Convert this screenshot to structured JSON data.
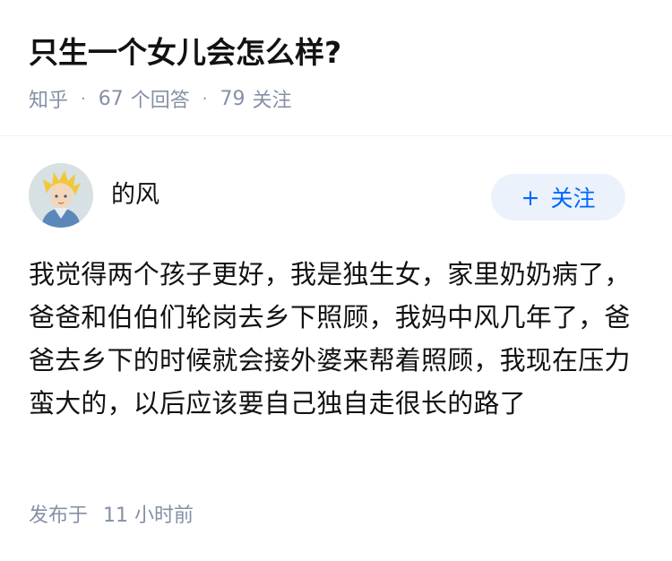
{
  "question": {
    "title": "只生一个女儿会怎么样?",
    "source": "知乎",
    "dot": "·",
    "answer_count": "67",
    "answer_label": "个回答",
    "follower_count": "79",
    "follower_label": "关注"
  },
  "answer": {
    "author_name": "的风",
    "avatar_icon": "anime-avatar-icon",
    "follow_button": {
      "icon": "+",
      "label": "关注"
    },
    "content": "我觉得两个孩子更好，我是独生女，家里奶奶病了，爸爸和伯伯们轮岗去乡下照顾，我妈中风几年了，爸爸去乡下的时候就会接外婆来帮着照顾，我现在压力蛮大的，以后应该要自己独自走很长的路了",
    "published_label": "发布于",
    "published_time": "11 小时前"
  },
  "colors": {
    "accent": "#0066ff",
    "follow_button_bg": "#ebf2fb",
    "meta_text": "#8590a6",
    "title_text": "#121212"
  }
}
